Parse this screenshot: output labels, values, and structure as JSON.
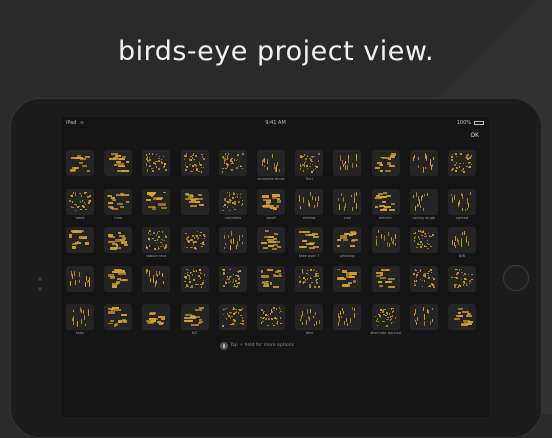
{
  "headline": "birds-eye project view.",
  "status_bar": {
    "device": "iPad",
    "time": "9:41 AM",
    "battery": "100%"
  },
  "toolbar": {
    "ok_label": "OK"
  },
  "projects": [
    {
      "label": ""
    },
    {
      "label": ""
    },
    {
      "label": ""
    },
    {
      "label": ""
    },
    {
      "label": ""
    },
    {
      "label": "scramble blues"
    },
    {
      "label": "fluri"
    },
    {
      "label": ""
    },
    {
      "label": ""
    },
    {
      "label": ""
    },
    {
      "label": ""
    },
    {
      "label": "tabla"
    },
    {
      "label": "men"
    },
    {
      "label": ""
    },
    {
      "label": ""
    },
    {
      "label": "variables"
    },
    {
      "label": "woolf"
    },
    {
      "label": "mellow"
    },
    {
      "label": "cool"
    },
    {
      "label": "electric"
    },
    {
      "label": "racing rough"
    },
    {
      "label": "spread"
    },
    {
      "label": ""
    },
    {
      "label": ""
    },
    {
      "label": "tabula rasa"
    },
    {
      "label": ""
    },
    {
      "label": ""
    },
    {
      "label": ""
    },
    {
      "label": "take over 7"
    },
    {
      "label": "phasing"
    },
    {
      "label": ""
    },
    {
      "label": ""
    },
    {
      "label": "8/8"
    },
    {
      "label": ""
    },
    {
      "label": ""
    },
    {
      "label": ""
    },
    {
      "label": ""
    },
    {
      "label": ""
    },
    {
      "label": ""
    },
    {
      "label": ""
    },
    {
      "label": ""
    },
    {
      "label": ""
    },
    {
      "label": ""
    },
    {
      "label": ""
    },
    {
      "label": "tabs"
    },
    {
      "label": ""
    },
    {
      "label": ""
    },
    {
      "label": "6/2"
    },
    {
      "label": ""
    },
    {
      "label": ""
    },
    {
      "label": "bird"
    },
    {
      "label": ""
    },
    {
      "label": "alternate bounce"
    },
    {
      "label": ""
    },
    {
      "label": ""
    }
  ],
  "hint": {
    "text": "Tap + hold for more options",
    "icon": "touch-icon"
  },
  "accent_color": "#d7a32c"
}
